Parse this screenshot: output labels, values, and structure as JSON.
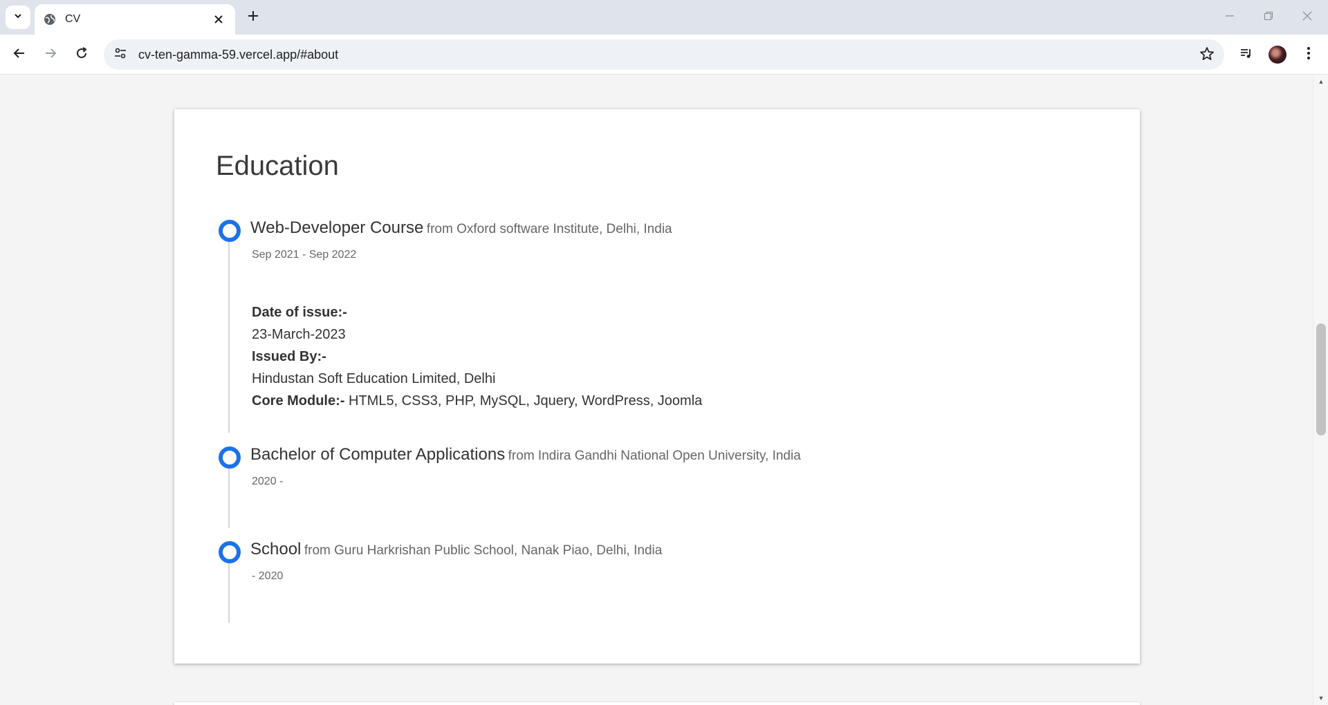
{
  "browser": {
    "tab_title": "CV",
    "url": "cv-ten-gamma-59.vercel.app/#about"
  },
  "education": {
    "title": "Education",
    "entries": [
      {
        "title": "Web-Developer Course",
        "from": "from Oxford software Institute, Delhi, India",
        "date": "Sep 2021 - Sep 2022",
        "date_of_issue_label": "Date of issue:-",
        "date_of_issue": "23-March-2023",
        "issued_by_label": "Issued By:-",
        "issued_by": "Hindustan Soft Education Limited, Delhi",
        "core_module_label": "Core Module:-",
        "core_module": " HTML5, CSS3, PHP, MySQL, Jquery, WordPress, Joomla"
      },
      {
        "title": "Bachelor of Computer Applications",
        "from": "from Indira Gandhi National Open University, India",
        "date": "2020 -"
      },
      {
        "title": "School",
        "from": "from Guru Harkrishan Public School, Nanak Piao, Delhi, India",
        "date": "- 2020"
      }
    ]
  },
  "colors": {
    "accent": "#1a73e8"
  }
}
